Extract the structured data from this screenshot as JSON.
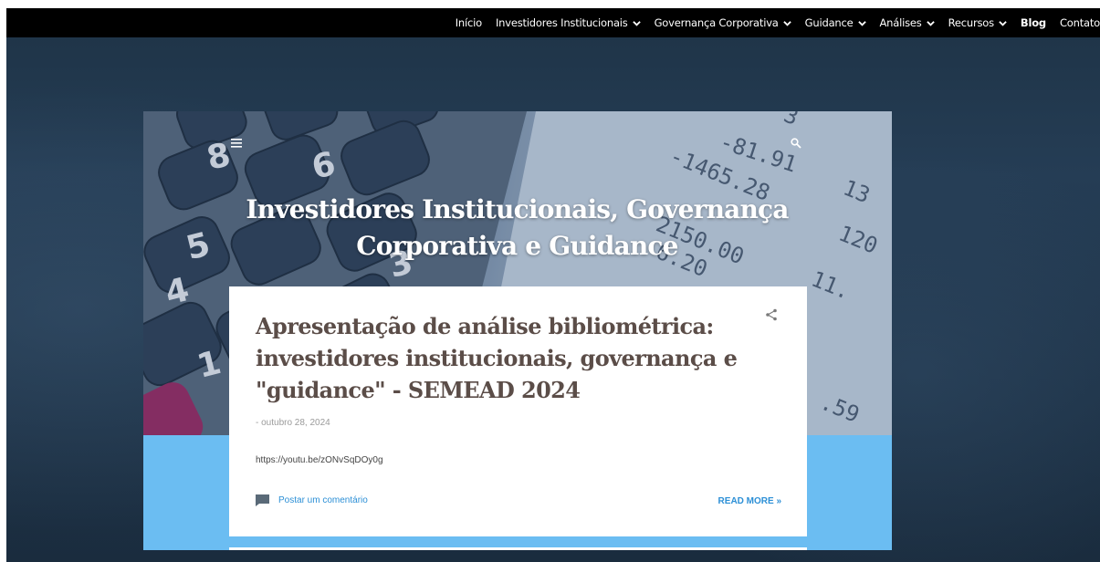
{
  "nav": {
    "items": [
      {
        "label": "Início",
        "dropdown": false,
        "bold": false
      },
      {
        "label": "Investidores Institucionais",
        "dropdown": true,
        "bold": false
      },
      {
        "label": "Governança Corporativa",
        "dropdown": true,
        "bold": false
      },
      {
        "label": "Guidance",
        "dropdown": true,
        "bold": false
      },
      {
        "label": "Análises",
        "dropdown": true,
        "bold": false
      },
      {
        "label": "Recursos",
        "dropdown": true,
        "bold": false
      },
      {
        "label": "Blog",
        "dropdown": false,
        "bold": true
      },
      {
        "label": "Contato",
        "dropdown": false,
        "bold": false
      }
    ]
  },
  "header": {
    "title": "Investidores Institucionais, Governança Corporativa e Guidance",
    "menu_icon": "hamburger-menu-icon",
    "search_icon": "search-icon"
  },
  "post": {
    "title": "Apresentação de análise bibliométrica: investidores institucionais, governança e \"guidance\" - SEMEAD 2024",
    "date": "- outubro 28, 2024",
    "body": "https://youtu.be/zONvSqDOy0g",
    "comment_label": "Postar um comentário",
    "read_more": "READ MORE »",
    "share_icon": "share-icon",
    "comment_icon": "comment-icon"
  },
  "colors": {
    "nav_bg": "#000000",
    "page_bg": "#253d55",
    "band": "#6bbdf2",
    "link": "#2c8fd6",
    "title": "#5b4d48"
  }
}
